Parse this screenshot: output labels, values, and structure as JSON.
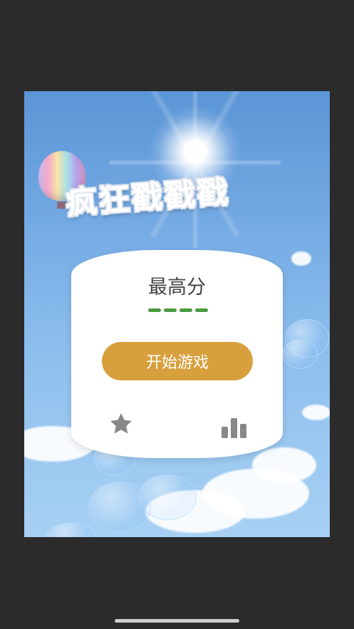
{
  "game": {
    "title": "疯狂戳戳戳"
  },
  "menu_card": {
    "high_score_label": "最高分",
    "high_score_value": "----",
    "start_button_label": "开始游戏",
    "star_icon": "star-icon",
    "rank_icon": "bar-chart-icon"
  },
  "colors": {
    "background_outer": "#2b2b2b",
    "sky_top": "#5b95d6",
    "start_button": "#d7a03d",
    "score_dash": "#4a9a3f",
    "icon_gray": "#888888"
  }
}
